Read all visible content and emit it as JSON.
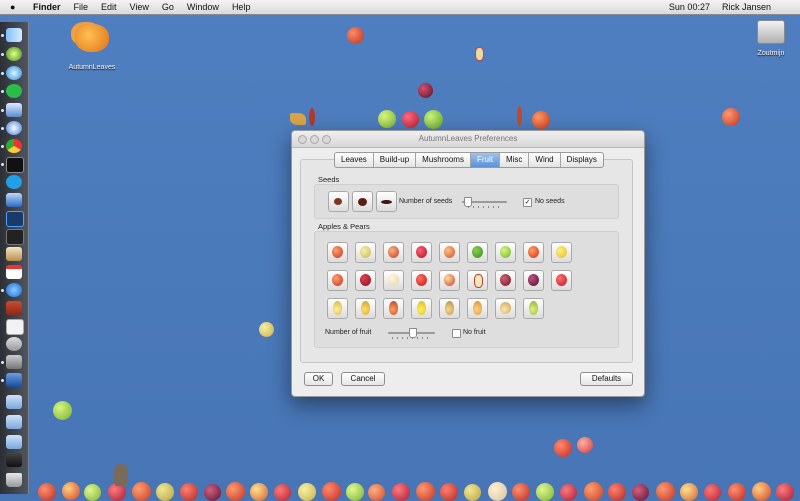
{
  "menubar": {
    "apple": "",
    "items": [
      "Finder",
      "File",
      "Edit",
      "View",
      "Go",
      "Window",
      "Help"
    ],
    "clock": "Sun 00:27",
    "user": "Rick Jansen"
  },
  "desktop": {
    "app_icon_label": "AutumnLeaves",
    "drive_label": "Zoutmijn"
  },
  "window": {
    "title": "AutumnLeaves Preferences",
    "tabs": [
      "Leaves",
      "Build-up",
      "Mushrooms",
      "Fruit",
      "Misc",
      "Wind",
      "Displays"
    ],
    "active_tab": "Fruit",
    "seeds": {
      "label": "Seeds",
      "slider_label": "Number of seeds",
      "slider_value": 0,
      "checkbox_label": "No seeds",
      "checkbox_checked": true
    },
    "apples": {
      "label": "Apples & Pears",
      "slider_label": "Number of fruit",
      "slider_value": 0.5,
      "checkbox_label": "No fruit",
      "checkbox_checked": false
    },
    "buttons": {
      "ok": "OK",
      "cancel": "Cancel",
      "defaults": "Defaults"
    }
  },
  "colors": {
    "desktop": "#4a78b8",
    "tab_active": "#5c92d6"
  }
}
